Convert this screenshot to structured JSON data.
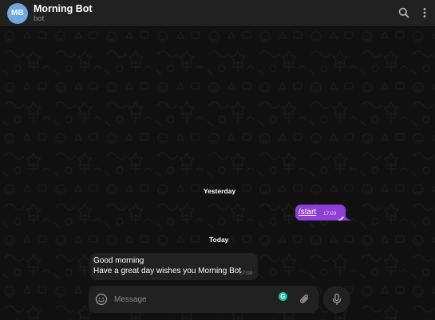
{
  "chat": {
    "avatar_initials": "MB",
    "title": "Morning Bot",
    "subtitle": "bot"
  },
  "header_icons": {
    "search": "search-icon",
    "menu": "more-vertical-icon"
  },
  "messages": {
    "date_yesterday": "Yesterday",
    "date_today": "Today",
    "outgoing": {
      "text": "/start",
      "time": "17:09",
      "status_icon": "double-check-icon"
    },
    "incoming": {
      "line1": "Good morning",
      "line2": "Have a great day wishes you Morning Bot",
      "time": "07:00"
    }
  },
  "composer": {
    "placeholder": "Message",
    "emoji_icon": "smile-icon",
    "grammarly_label": "G",
    "attach_icon": "paperclip-icon",
    "mic_icon": "microphone-icon"
  },
  "colors": {
    "header_bg": "#212121",
    "chat_bg": "#111111",
    "outgoing_bubble": "#8e3fd6",
    "incoming_bubble": "#212121",
    "avatar": "#6fa8dc",
    "grammarly": "#15c39a"
  }
}
